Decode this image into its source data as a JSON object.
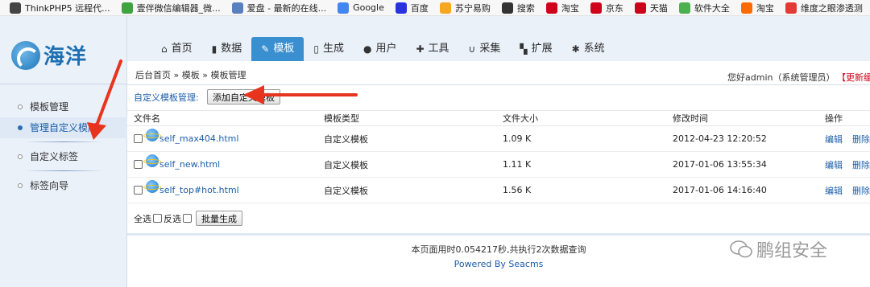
{
  "bookmarks": [
    {
      "label": "ThinkPHP5 远程代...",
      "icon": "page-icon",
      "color": "#444444"
    },
    {
      "label": "壹伴微信编辑器_微...",
      "icon": "check-circle-icon",
      "color": "#3fa33f"
    },
    {
      "label": "爱盘 - 最新的在线...",
      "icon": "crossed-box-icon",
      "color": "#5a7fbf"
    },
    {
      "label": "Google",
      "icon": "google-icon",
      "color": "#4285f4"
    },
    {
      "label": "百度",
      "icon": "baidu-paw-icon",
      "color": "#2932e1"
    },
    {
      "label": "苏宁易购",
      "icon": "lion-icon",
      "color": "#f5a623"
    },
    {
      "label": "搜索",
      "icon": "search-plus-icon",
      "color": "#333333"
    },
    {
      "label": "淘宝",
      "icon": "t-red-icon",
      "color": "#d0021b"
    },
    {
      "label": "京东",
      "icon": "jd-icon",
      "color": "#d0021b"
    },
    {
      "label": "天猫",
      "icon": "t-red-icon",
      "color": "#d0021b"
    },
    {
      "label": "软件大全",
      "icon": "download-icon",
      "color": "#4caf50"
    },
    {
      "label": "淘宝",
      "icon": "taobao-icon",
      "color": "#ff6a00"
    },
    {
      "label": "维度之眼渗透测",
      "icon": "g-red-icon",
      "color": "#e53935"
    }
  ],
  "logo": {
    "text": "海洋"
  },
  "sidebar": {
    "items": [
      {
        "label": "模板管理",
        "active": false
      },
      {
        "label": "管理自定义模版",
        "active": true
      },
      {
        "label": "自定义标签",
        "active": false
      },
      {
        "label": "标签向导",
        "active": false
      }
    ]
  },
  "nav": {
    "tabs": [
      {
        "label": "首页",
        "icon": "home-icon",
        "glyph": "⌂",
        "active": false
      },
      {
        "label": "数据",
        "icon": "book-icon",
        "glyph": "▮",
        "active": false
      },
      {
        "label": "模板",
        "icon": "edit-icon",
        "glyph": "✎",
        "active": true
      },
      {
        "label": "生成",
        "icon": "file-icon",
        "glyph": "▯",
        "active": false
      },
      {
        "label": "用户",
        "icon": "user-icon",
        "glyph": "●",
        "active": false
      },
      {
        "label": "工具",
        "icon": "wrench-icon",
        "glyph": "✚",
        "active": false
      },
      {
        "label": "采集",
        "icon": "magnet-icon",
        "glyph": "∪",
        "active": false
      },
      {
        "label": "扩展",
        "icon": "sitemap-icon",
        "glyph": "▚",
        "active": false
      },
      {
        "label": "系统",
        "icon": "gear-icon",
        "glyph": "✱",
        "active": false
      }
    ]
  },
  "breadcrumb": "后台首页 » 模板 » 模板管理",
  "user": {
    "greeting": "您好admin（系统管理员）",
    "refresh": "【更新缓存"
  },
  "toolbar": {
    "label": "自定义模板管理:",
    "add_button": "添加自定义模板"
  },
  "table": {
    "headers": [
      "文件名",
      "模板类型",
      "文件大小",
      "修改时间",
      "操作"
    ],
    "rows": [
      {
        "name": "self_max404.html",
        "type": "自定义模板",
        "size": "1.09 K",
        "time": "2012-04-23 12:20:52",
        "edit": "编辑",
        "del": "删除"
      },
      {
        "name": "self_new.html",
        "type": "自定义模板",
        "size": "1.11 K",
        "time": "2017-01-06 13:55:34",
        "edit": "编辑",
        "del": "删除"
      },
      {
        "name": "self_top#hot.html",
        "type": "自定义模板",
        "size": "1.56 K",
        "time": "2017-01-06 14:16:40",
        "edit": "编辑",
        "del": "删除"
      }
    ]
  },
  "bulk": {
    "select_all": "全选",
    "invert": "反选",
    "batch_button": "批量生成"
  },
  "footer": {
    "stats": "本页面用时0.054217秒,共执行2次数据查询",
    "powered": "Powered By Seacms"
  },
  "watermark": {
    "text": "鹏组安全"
  }
}
